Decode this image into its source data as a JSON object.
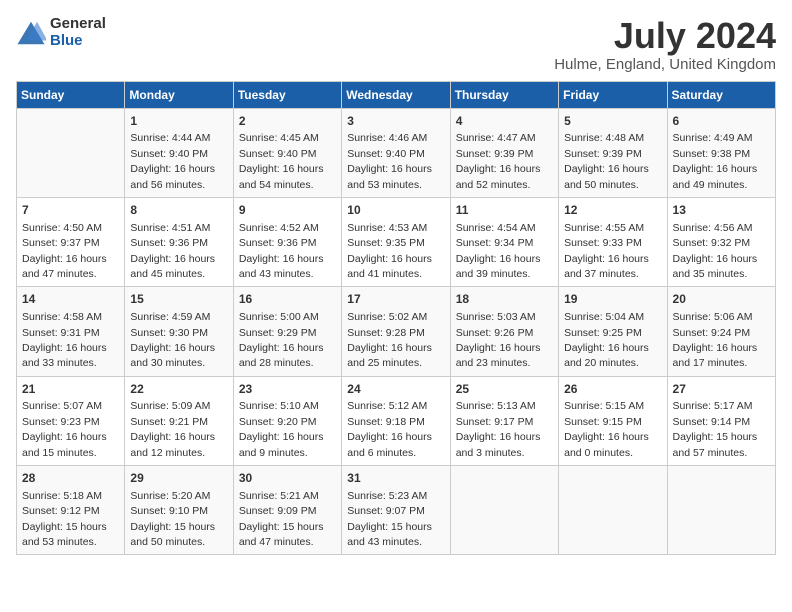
{
  "header": {
    "logo_general": "General",
    "logo_blue": "Blue",
    "month": "July 2024",
    "location": "Hulme, England, United Kingdom"
  },
  "days_of_week": [
    "Sunday",
    "Monday",
    "Tuesday",
    "Wednesday",
    "Thursday",
    "Friday",
    "Saturday"
  ],
  "weeks": [
    [
      {
        "day": "",
        "info": ""
      },
      {
        "day": "1",
        "info": "Sunrise: 4:44 AM\nSunset: 9:40 PM\nDaylight: 16 hours\nand 56 minutes."
      },
      {
        "day": "2",
        "info": "Sunrise: 4:45 AM\nSunset: 9:40 PM\nDaylight: 16 hours\nand 54 minutes."
      },
      {
        "day": "3",
        "info": "Sunrise: 4:46 AM\nSunset: 9:40 PM\nDaylight: 16 hours\nand 53 minutes."
      },
      {
        "day": "4",
        "info": "Sunrise: 4:47 AM\nSunset: 9:39 PM\nDaylight: 16 hours\nand 52 minutes."
      },
      {
        "day": "5",
        "info": "Sunrise: 4:48 AM\nSunset: 9:39 PM\nDaylight: 16 hours\nand 50 minutes."
      },
      {
        "day": "6",
        "info": "Sunrise: 4:49 AM\nSunset: 9:38 PM\nDaylight: 16 hours\nand 49 minutes."
      }
    ],
    [
      {
        "day": "7",
        "info": "Sunrise: 4:50 AM\nSunset: 9:37 PM\nDaylight: 16 hours\nand 47 minutes."
      },
      {
        "day": "8",
        "info": "Sunrise: 4:51 AM\nSunset: 9:36 PM\nDaylight: 16 hours\nand 45 minutes."
      },
      {
        "day": "9",
        "info": "Sunrise: 4:52 AM\nSunset: 9:36 PM\nDaylight: 16 hours\nand 43 minutes."
      },
      {
        "day": "10",
        "info": "Sunrise: 4:53 AM\nSunset: 9:35 PM\nDaylight: 16 hours\nand 41 minutes."
      },
      {
        "day": "11",
        "info": "Sunrise: 4:54 AM\nSunset: 9:34 PM\nDaylight: 16 hours\nand 39 minutes."
      },
      {
        "day": "12",
        "info": "Sunrise: 4:55 AM\nSunset: 9:33 PM\nDaylight: 16 hours\nand 37 minutes."
      },
      {
        "day": "13",
        "info": "Sunrise: 4:56 AM\nSunset: 9:32 PM\nDaylight: 16 hours\nand 35 minutes."
      }
    ],
    [
      {
        "day": "14",
        "info": "Sunrise: 4:58 AM\nSunset: 9:31 PM\nDaylight: 16 hours\nand 33 minutes."
      },
      {
        "day": "15",
        "info": "Sunrise: 4:59 AM\nSunset: 9:30 PM\nDaylight: 16 hours\nand 30 minutes."
      },
      {
        "day": "16",
        "info": "Sunrise: 5:00 AM\nSunset: 9:29 PM\nDaylight: 16 hours\nand 28 minutes."
      },
      {
        "day": "17",
        "info": "Sunrise: 5:02 AM\nSunset: 9:28 PM\nDaylight: 16 hours\nand 25 minutes."
      },
      {
        "day": "18",
        "info": "Sunrise: 5:03 AM\nSunset: 9:26 PM\nDaylight: 16 hours\nand 23 minutes."
      },
      {
        "day": "19",
        "info": "Sunrise: 5:04 AM\nSunset: 9:25 PM\nDaylight: 16 hours\nand 20 minutes."
      },
      {
        "day": "20",
        "info": "Sunrise: 5:06 AM\nSunset: 9:24 PM\nDaylight: 16 hours\nand 17 minutes."
      }
    ],
    [
      {
        "day": "21",
        "info": "Sunrise: 5:07 AM\nSunset: 9:23 PM\nDaylight: 16 hours\nand 15 minutes."
      },
      {
        "day": "22",
        "info": "Sunrise: 5:09 AM\nSunset: 9:21 PM\nDaylight: 16 hours\nand 12 minutes."
      },
      {
        "day": "23",
        "info": "Sunrise: 5:10 AM\nSunset: 9:20 PM\nDaylight: 16 hours\nand 9 minutes."
      },
      {
        "day": "24",
        "info": "Sunrise: 5:12 AM\nSunset: 9:18 PM\nDaylight: 16 hours\nand 6 minutes."
      },
      {
        "day": "25",
        "info": "Sunrise: 5:13 AM\nSunset: 9:17 PM\nDaylight: 16 hours\nand 3 minutes."
      },
      {
        "day": "26",
        "info": "Sunrise: 5:15 AM\nSunset: 9:15 PM\nDaylight: 16 hours\nand 0 minutes."
      },
      {
        "day": "27",
        "info": "Sunrise: 5:17 AM\nSunset: 9:14 PM\nDaylight: 15 hours\nand 57 minutes."
      }
    ],
    [
      {
        "day": "28",
        "info": "Sunrise: 5:18 AM\nSunset: 9:12 PM\nDaylight: 15 hours\nand 53 minutes."
      },
      {
        "day": "29",
        "info": "Sunrise: 5:20 AM\nSunset: 9:10 PM\nDaylight: 15 hours\nand 50 minutes."
      },
      {
        "day": "30",
        "info": "Sunrise: 5:21 AM\nSunset: 9:09 PM\nDaylight: 15 hours\nand 47 minutes."
      },
      {
        "day": "31",
        "info": "Sunrise: 5:23 AM\nSunset: 9:07 PM\nDaylight: 15 hours\nand 43 minutes."
      },
      {
        "day": "",
        "info": ""
      },
      {
        "day": "",
        "info": ""
      },
      {
        "day": "",
        "info": ""
      }
    ]
  ]
}
